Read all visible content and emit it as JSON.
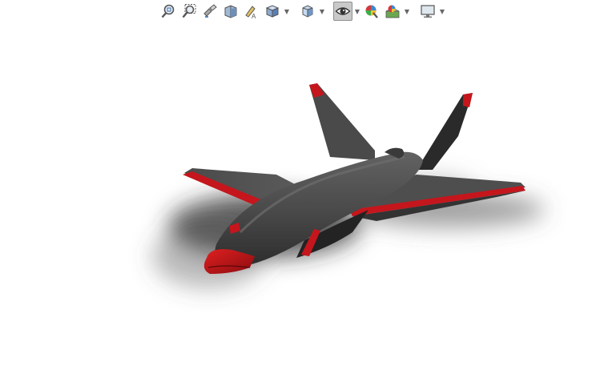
{
  "toolbar": {
    "buttons": [
      {
        "id": "zoom-to-fit",
        "icon": "zoom-to-fit-icon"
      },
      {
        "id": "zoom-to-area",
        "icon": "zoom-to-area-icon"
      },
      {
        "id": "previous-view",
        "icon": "previous-view-icon"
      },
      {
        "id": "section-view",
        "icon": "section-view-icon"
      },
      {
        "id": "dynamic-annotation",
        "icon": "dynamic-annotation-icon"
      },
      {
        "id": "view-orientation",
        "icon": "view-orientation-icon",
        "dropdown": true
      },
      {
        "id": "display-style",
        "icon": "display-style-icon",
        "dropdown": true
      },
      {
        "id": "hide-show-items",
        "icon": "eye-icon",
        "dropdown": true,
        "active": true
      },
      {
        "id": "edit-appearance",
        "icon": "appearance-icon"
      },
      {
        "id": "apply-scene",
        "icon": "scene-icon",
        "dropdown": true
      },
      {
        "id": "view-settings",
        "icon": "monitor-icon",
        "dropdown": true
      }
    ]
  },
  "model": {
    "name": "",
    "body_color": "#4a4a4a",
    "accent_color": "#c4161c",
    "shadow_color": "#3a3a3a"
  },
  "colors": {
    "background": "#ffffff",
    "toolbar_active_bg": "#c9c9c9",
    "icon_blue": "#3a6fb0",
    "icon_gray": "#6e6e6e"
  }
}
